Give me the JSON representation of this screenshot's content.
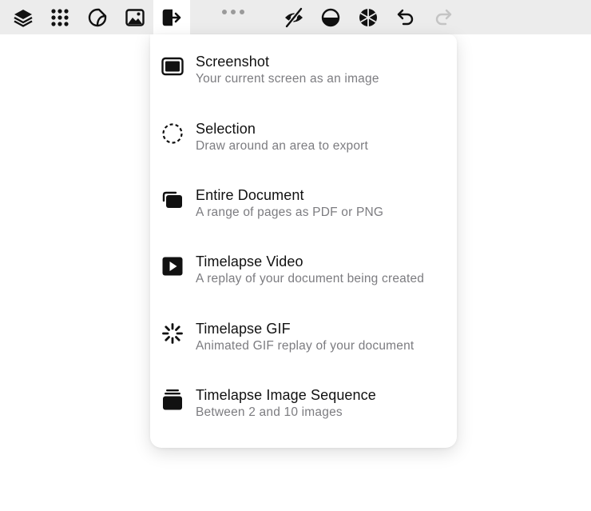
{
  "toolbar": {
    "buttons": [
      {
        "icon": "layers-icon"
      },
      {
        "icon": "grid-dots-icon"
      },
      {
        "icon": "sticker-icon"
      },
      {
        "icon": "image-icon"
      },
      {
        "icon": "export-icon",
        "active": true
      },
      {
        "icon": "more-icon"
      },
      {
        "icon": "hide-icon"
      },
      {
        "icon": "half-circle-icon"
      },
      {
        "icon": "aperture-icon"
      },
      {
        "icon": "undo-icon"
      },
      {
        "icon": "redo-icon",
        "disabled": true
      }
    ]
  },
  "export_menu": {
    "items": [
      {
        "title": "Screenshot",
        "description": "Your current screen as an image",
        "icon": "screenshot-icon"
      },
      {
        "title": "Selection",
        "description": "Draw around an area to export",
        "icon": "selection-icon"
      },
      {
        "title": "Entire Document",
        "description": "A range of pages as PDF or PNG",
        "icon": "document-pages-icon"
      },
      {
        "title": "Timelapse Video",
        "description": "A replay of your document being created",
        "icon": "video-play-icon"
      },
      {
        "title": "Timelapse GIF",
        "description": "Animated GIF replay of your document",
        "icon": "gif-spinner-icon"
      },
      {
        "title": "Timelapse Image Sequence",
        "description": "Between 2 and 10 images",
        "icon": "image-stack-icon"
      }
    ]
  },
  "colors": {
    "toolbar_bg": "#ececec",
    "icon": "#111111",
    "icon_disabled": "#c4c4c4",
    "title": "#111111",
    "description": "#7c7c80"
  }
}
